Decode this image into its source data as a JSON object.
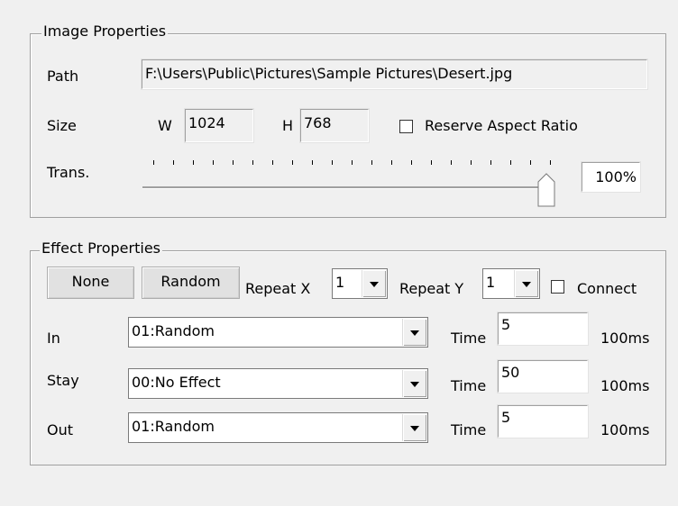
{
  "image_properties": {
    "title": "Image Properties",
    "path_label": "Path",
    "path_value": "F:\\Users\\Public\\Pictures\\Sample Pictures\\Desert.jpg",
    "size_label": "Size",
    "w_label": "W",
    "w_value": "1024",
    "h_label": "H",
    "h_value": "768",
    "reserve_aspect_label": "Reserve Aspect Ratio",
    "reserve_aspect_checked": false,
    "trans_label": "Trans.",
    "trans_value": "100%",
    "trans_fraction": 1.0
  },
  "effect_properties": {
    "title": "Effect Properties",
    "none_button": "None",
    "random_button": "Random",
    "repeat_x_label": "Repeat X",
    "repeat_x_value": "1",
    "repeat_y_label": "Repeat Y",
    "repeat_y_value": "1",
    "connect_label": "Connect",
    "connect_checked": false,
    "rows": [
      {
        "label": "In",
        "effect": "01:Random",
        "time_label": "Time",
        "time_value": "5",
        "unit": "100ms"
      },
      {
        "label": "Stay",
        "effect": "00:No Effect",
        "time_label": "Time",
        "time_value": "50",
        "unit": "100ms"
      },
      {
        "label": "Out",
        "effect": "01:Random",
        "time_label": "Time",
        "time_value": "5",
        "unit": "100ms"
      }
    ]
  }
}
